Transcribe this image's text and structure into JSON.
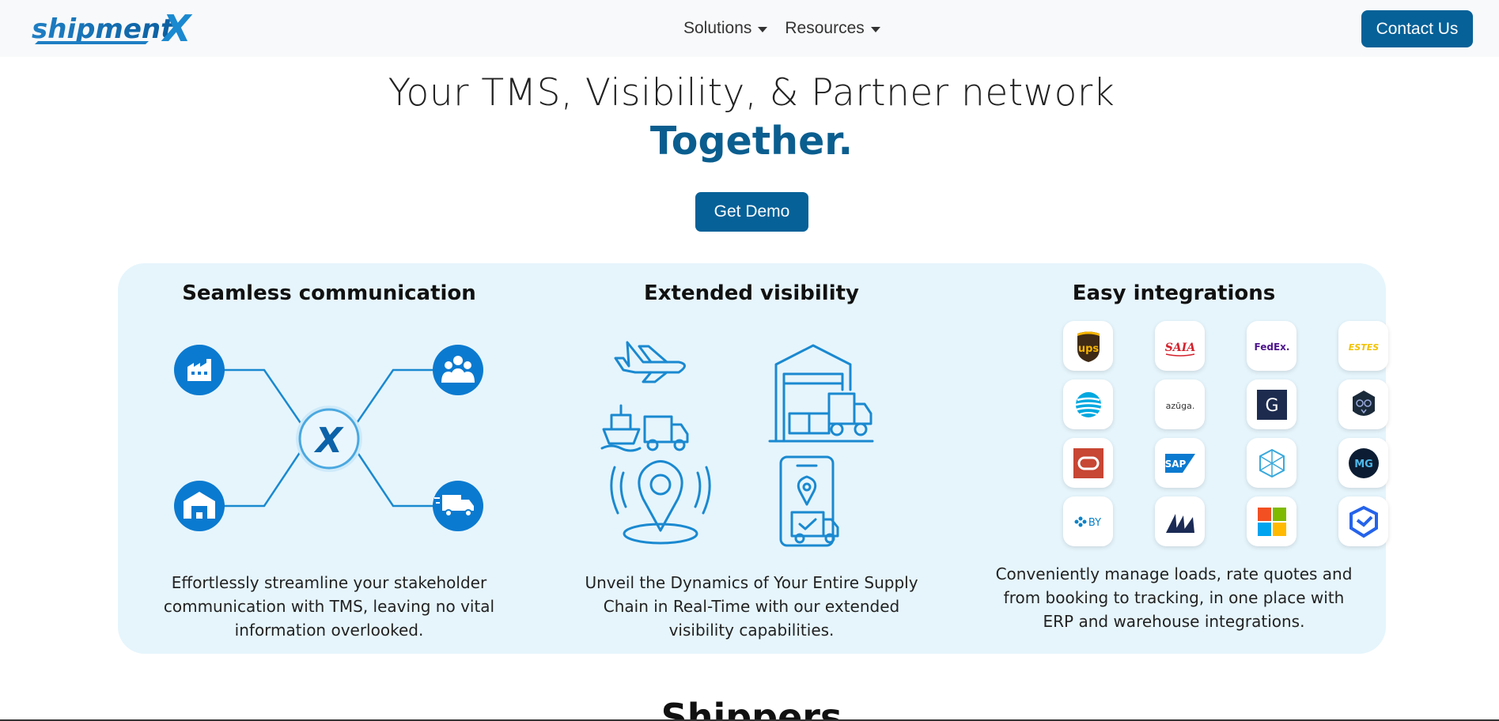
{
  "brand": {
    "logo_text_1": "shipment",
    "logo_text_2": "X",
    "primary_color": "#056198",
    "accent_color": "#1a89d0"
  },
  "nav": {
    "items": [
      {
        "label": "Solutions"
      },
      {
        "label": "Resources"
      }
    ],
    "contact_label": "Contact Us"
  },
  "hero": {
    "title": "Your TMS, Visibility, & Partner network",
    "subtitle": "Together.",
    "demo_label": "Get Demo"
  },
  "features": [
    {
      "title": "Seamless communication",
      "description": "Effortlessly streamline your stakeholder communication with TMS, leaving no vital information overlooked.",
      "icons": [
        "factory-icon",
        "people-icon",
        "warehouse-icon",
        "truck-icon",
        "shipmentx-hub-icon"
      ]
    },
    {
      "title": "Extended visibility",
      "description": "Unveil the Dynamics of Your Entire Supply Chain in Real-Time with our extended visibility capabilities.",
      "icons": [
        "plane-ship-truck-icon",
        "warehouse-truck-icon",
        "location-pin-icon",
        "mobile-tracking-icon"
      ]
    },
    {
      "title": "Easy integrations",
      "description": "Conveniently manage loads, rate quotes and from booking to tracking, in one place with ERP and warehouse integrations.",
      "logos": [
        {
          "name": "UPS",
          "text": "ups"
        },
        {
          "name": "SAIA",
          "text": "SAIA"
        },
        {
          "name": "FedEx",
          "text": "FedEx."
        },
        {
          "name": "Estes",
          "text": "ESTES"
        },
        {
          "name": "AT&T",
          "text": ""
        },
        {
          "name": "Azuga",
          "text": "azūga."
        },
        {
          "name": "G",
          "text": "G"
        },
        {
          "name": "Owl",
          "text": ""
        },
        {
          "name": "Oracle",
          "text": ""
        },
        {
          "name": "SAP",
          "text": "SAP"
        },
        {
          "name": "Cube",
          "text": ""
        },
        {
          "name": "MG",
          "text": "MG"
        },
        {
          "name": "Blue Yonder",
          "text": "BY"
        },
        {
          "name": "Manhattan",
          "text": ""
        },
        {
          "name": "Microsoft",
          "text": ""
        },
        {
          "name": "Shield",
          "text": ""
        }
      ]
    }
  ],
  "next_section": {
    "title": "Shippers"
  }
}
